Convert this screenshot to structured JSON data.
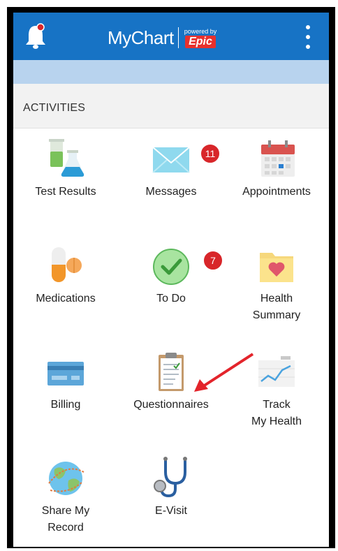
{
  "header": {
    "app_name": "MyChart",
    "powered_by": "powered by",
    "brand": "Epic",
    "notification_icon": "bell-icon",
    "menu_icon": "more-vert-icon"
  },
  "section": {
    "title": "ACTIVITIES"
  },
  "activities": [
    {
      "id": "test-results",
      "lines": [
        "Test Results"
      ],
      "icon": "test-tubes-icon"
    },
    {
      "id": "messages",
      "lines": [
        "Messages"
      ],
      "icon": "envelope-icon",
      "badge": "11"
    },
    {
      "id": "appointments",
      "lines": [
        "Appointments"
      ],
      "icon": "calendar-icon"
    },
    {
      "id": "medications",
      "lines": [
        "Medications"
      ],
      "icon": "pills-icon"
    },
    {
      "id": "to-do",
      "lines": [
        "To Do"
      ],
      "icon": "checkmark-icon",
      "badge": "7"
    },
    {
      "id": "health-summary",
      "lines": [
        "Health",
        "Summary"
      ],
      "icon": "folder-heart-icon"
    },
    {
      "id": "billing",
      "lines": [
        "Billing"
      ],
      "icon": "credit-card-icon"
    },
    {
      "id": "questionnaires",
      "lines": [
        "Questionnaires"
      ],
      "icon": "clipboard-icon"
    },
    {
      "id": "track-my-health",
      "lines": [
        "Track",
        "My Health"
      ],
      "icon": "line-graph-icon"
    },
    {
      "id": "share-my-record",
      "lines": [
        "Share My",
        "Record"
      ],
      "icon": "globe-icon"
    },
    {
      "id": "e-visit",
      "lines": [
        "E-Visit"
      ],
      "icon": "stethoscope-icon"
    }
  ],
  "colors": {
    "header": "#1773c5",
    "subbar": "#b8d3ee",
    "badge": "#d8262a",
    "annotation_arrow": "#e3242b"
  }
}
